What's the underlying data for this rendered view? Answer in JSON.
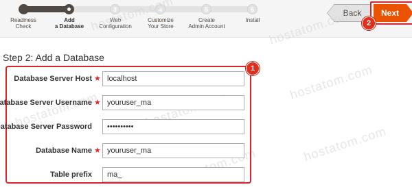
{
  "wizard": {
    "progress_fraction": 0.2,
    "steps": [
      {
        "number": "",
        "line1": "Readiness",
        "line2": "Check",
        "state": "done"
      },
      {
        "number": "",
        "line1": "Add",
        "line2": "a Database",
        "state": "active"
      },
      {
        "number": "3",
        "line1": "Web",
        "line2": "Configuration",
        "state": "pending"
      },
      {
        "number": "4",
        "line1": "Customize",
        "line2": "Your Store",
        "state": "pending"
      },
      {
        "number": "5",
        "line1": "Create",
        "line2": "Admin Account",
        "state": "pending"
      },
      {
        "number": "6",
        "line1": "Install",
        "line2": "",
        "state": "pending"
      }
    ],
    "back_label": "Back",
    "next_label": "Next"
  },
  "page": {
    "title": "Step 2: Add a Database"
  },
  "form": {
    "host": {
      "label": "Database Server Host",
      "required": "★",
      "value": "localhost"
    },
    "username": {
      "label": "Database Server Username",
      "required": "★",
      "value": "youruser_ma"
    },
    "password": {
      "label": "Database Server Password",
      "required": "",
      "value": "••••••••••"
    },
    "dbname": {
      "label": "Database Name",
      "required": "★",
      "value": "youruser_ma"
    },
    "prefix": {
      "label": "Table prefix",
      "required": "",
      "value": "ma_"
    }
  },
  "annotations": {
    "badge_form": "1",
    "badge_next": "2"
  },
  "watermark": {
    "text": "hostatom.com"
  },
  "colors": {
    "accent": "#eb5202",
    "annotation": "#d9232d",
    "progress": "#514943"
  }
}
